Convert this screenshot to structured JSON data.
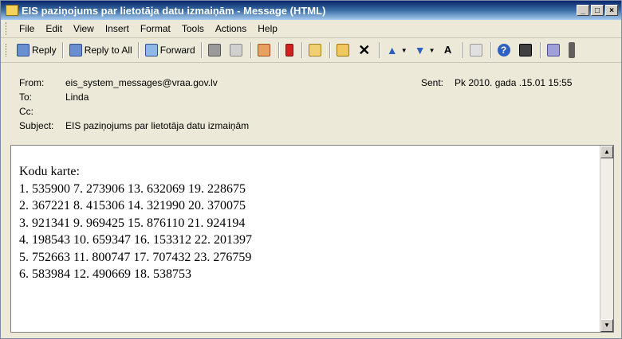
{
  "window": {
    "title": "EIS paziņojums par lietotāja datu izmaiņām - Message (HTML)"
  },
  "menu": [
    "File",
    "Edit",
    "View",
    "Insert",
    "Format",
    "Tools",
    "Actions",
    "Help"
  ],
  "toolbar": {
    "reply": "Reply",
    "reply_all": "Reply to All",
    "forward": "Forward"
  },
  "header": {
    "from_label": "From:",
    "from_value": "eis_system_messages@vraa.gov.lv",
    "to_label": "To:",
    "to_value": "Linda",
    "cc_label": "Cc:",
    "cc_value": "",
    "subject_label": "Subject:",
    "subject_value": "EIS paziņojums par lietotāja datu izmaiņām",
    "sent_label": "Sent:",
    "sent_value": "Pk 2010.  gada .15.01 15:55"
  },
  "body": {
    "lines": [
      "Kodu karte:",
      "1. 535900 7. 273906 13. 632069 19. 228675",
      "2. 367221 8. 415306 14. 321990 20. 370075",
      "3. 921341 9. 969425 15. 876110 21. 924194",
      "4. 198543 10. 659347 16. 153312 22. 201397",
      "5. 752663 11. 800747 17. 707432 23. 276759",
      "6. 583984 12. 490669 18. 538753"
    ]
  }
}
